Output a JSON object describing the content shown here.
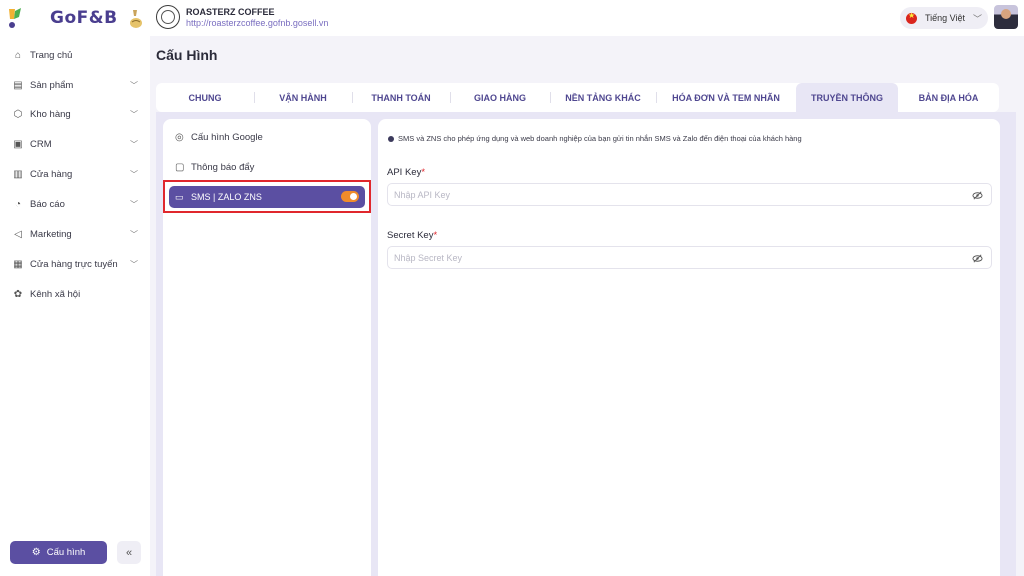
{
  "brand": {
    "name": "GoF&B"
  },
  "store": {
    "name": "ROASTERZ COFFEE",
    "url": "http://roasterzcoffee.gofnb.gosell.vn"
  },
  "language": {
    "label": "Tiếng Việt"
  },
  "sidebar": {
    "items": [
      {
        "label": "Trang chủ",
        "icon": "home-icon"
      },
      {
        "label": "Sản phẩm",
        "icon": "product-icon"
      },
      {
        "label": "Kho hàng",
        "icon": "inventory-icon"
      },
      {
        "label": "CRM",
        "icon": "crm-icon"
      },
      {
        "label": "Cửa hàng",
        "icon": "store-icon"
      },
      {
        "label": "Báo cáo",
        "icon": "report-icon"
      },
      {
        "label": "Marketing",
        "icon": "marketing-icon"
      },
      {
        "label": "Cửa hàng trực tuyến",
        "icon": "online-store-icon"
      },
      {
        "label": "Kênh xã hội",
        "icon": "social-icon"
      }
    ],
    "config_button": "Cấu hình"
  },
  "page": {
    "title": "Cấu Hình"
  },
  "tabs": [
    {
      "label": "CHUNG"
    },
    {
      "label": "VẬN HÀNH"
    },
    {
      "label": "THANH TOÁN"
    },
    {
      "label": "GIAO HÀNG"
    },
    {
      "label": "NỀN TẢNG KHÁC"
    },
    {
      "label": "HÓA ĐƠN VÀ TEM NHÃN"
    },
    {
      "label": "TRUYỀN THÔNG",
      "active": true
    },
    {
      "label": "BẢN ĐỊA HÓA"
    }
  ],
  "settings_menu": {
    "items": [
      {
        "label": "Cấu hình Google"
      },
      {
        "label": "Thông báo đẩy"
      },
      {
        "label": "SMS | ZALO ZNS",
        "selected": true,
        "toggle": true
      }
    ]
  },
  "sms_panel": {
    "info": "SMS và ZNS cho phép ứng dụng và web doanh nghiệp của bạn gửi tin nhắn SMS và Zalo đến điện thoại của khách hàng",
    "api_key": {
      "label": "API Key",
      "required": "*",
      "placeholder": "Nhập API Key",
      "value": ""
    },
    "secret_key": {
      "label": "Secret Key",
      "required": "*",
      "placeholder": "Nhập Secret Key",
      "value": ""
    }
  },
  "colors": {
    "primary": "#5b4fa2",
    "toggle_on": "#f08c2b",
    "highlight": "#e0272d"
  }
}
